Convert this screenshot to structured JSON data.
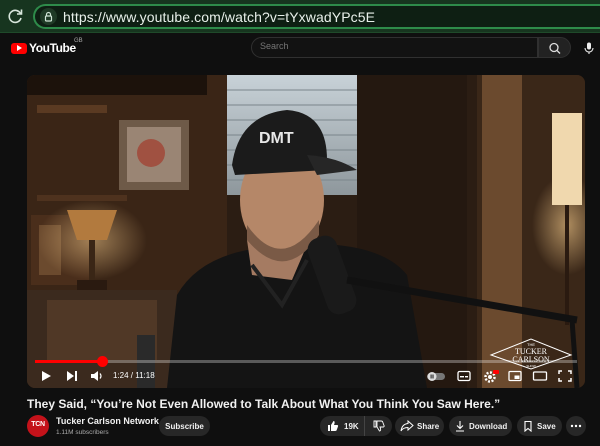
{
  "browser": {
    "url": "https://www.youtube.com/watch?v=tYxwadYPc5E"
  },
  "header": {
    "logo_text": "YouTube",
    "region": "GB",
    "search_placeholder": "Search"
  },
  "video": {
    "time_display": "1:24 / 11:18",
    "progress_fraction": 0.124,
    "watermark_lines": [
      "THE",
      "TUCKER",
      "CARLSON",
      "SHOW"
    ],
    "cap_text": "DMT"
  },
  "meta": {
    "title": "They Said, “You’re Not Even Allowed to Talk About What You Think You Saw Here.”",
    "channel_name": "Tucker Carlson Network",
    "subscribers": "1.11M subscribers",
    "avatar_text": "TCN",
    "subscribe_label": "Subscribe",
    "like_count": "19K",
    "share_label": "Share",
    "download_label": "Download",
    "save_label": "Save"
  },
  "colors": {
    "accent": "#ff0000",
    "browser_green": "#2e8b4a"
  }
}
